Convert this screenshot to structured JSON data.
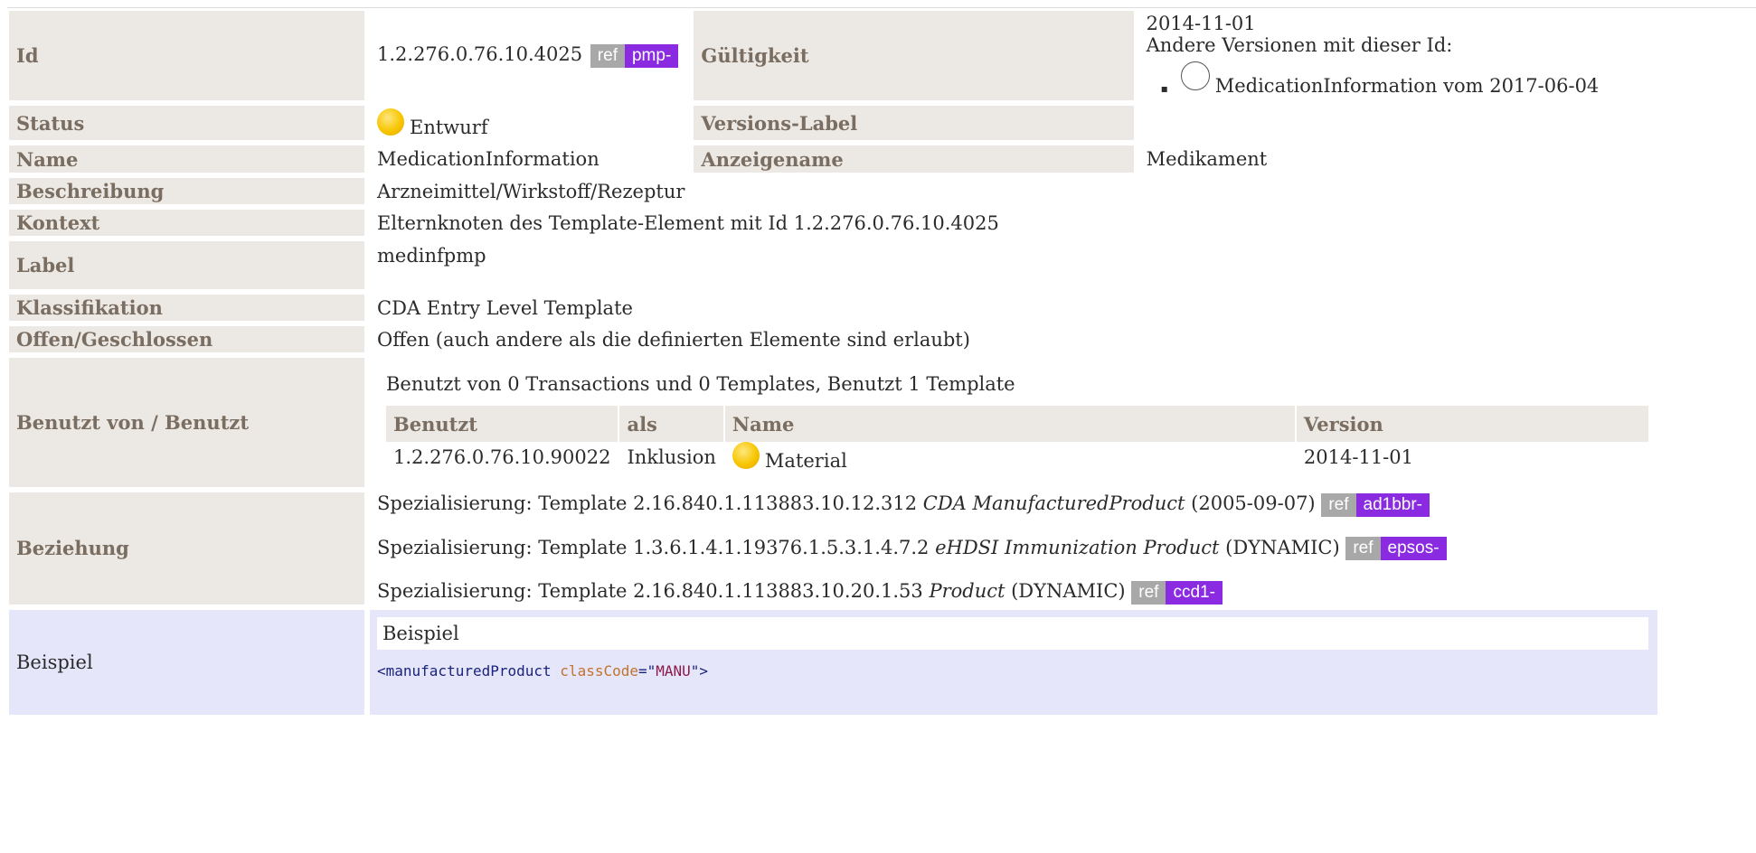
{
  "rows": {
    "id": {
      "label": "Id",
      "value": "1.2.276.0.76.10.4025",
      "ref": "ref",
      "prefix": "pmp-"
    },
    "validity": {
      "label": "Gültigkeit",
      "date": "2014-11-01",
      "other_versions": "Andere Versionen mit dieser Id:",
      "version_item": "MedicationInformation vom 2017-06-04"
    },
    "status": {
      "label": "Status",
      "value": "Entwurf"
    },
    "version_label": {
      "label": "Versions-Label"
    },
    "name": {
      "label": "Name",
      "value": "MedicationInformation"
    },
    "display_name": {
      "label": "Anzeigename",
      "value": "Medikament"
    },
    "description": {
      "label": "Beschreibung",
      "value": "Arzneimittel/Wirkstoff/Rezeptur"
    },
    "context": {
      "label": "Kontext",
      "value": "Elternknoten des Template-Element mit Id 1.2.276.0.76.10.4025"
    },
    "tag": {
      "label": "Label",
      "value": "medinfpmp"
    },
    "classification": {
      "label": "Klassifikation",
      "value": "CDA Entry Level Template"
    },
    "open_closed": {
      "label": "Offen/Geschlossen",
      "value": "Offen (auch andere als die definierten Elemente sind erlaubt)"
    },
    "used_by": {
      "label": "Benutzt von / Benutzt",
      "summary": "Benutzt von 0 Transactions und 0 Templates, Benutzt 1 Template",
      "headers": [
        "Benutzt",
        "als",
        "Name",
        "Version"
      ],
      "row": {
        "id": "1.2.276.0.76.10.90022",
        "as": "Inklusion",
        "name": "Material",
        "version": "2014-11-01"
      }
    },
    "relation": {
      "label": "Beziehung",
      "items": [
        {
          "prefix": "Spezialisierung: Template 2.16.840.1.113883.10.12.312 ",
          "name": "CDA ManufacturedProduct",
          "suffix": " (2005-09-07)",
          "ref": "ref",
          "tag": "ad1bbr-"
        },
        {
          "prefix": "Spezialisierung: Template 1.3.6.1.4.1.19376.1.5.3.1.4.7.2 ",
          "name": "eHDSI Immunization Product",
          "suffix": " (DYNAMIC)",
          "ref": "ref",
          "tag": "epsos-"
        },
        {
          "prefix": "Spezialisierung: Template 2.16.840.1.113883.10.20.1.53 ",
          "name": "Product",
          "suffix": " (DYNAMIC)",
          "ref": "ref",
          "tag": "ccd1-"
        }
      ]
    },
    "example": {
      "label": "Beispiel",
      "box_title": "Beispiel",
      "code_open": "<manufacturedProduct ",
      "code_attr": "classCode",
      "code_eq": "=\"",
      "code_value": "MANU",
      "code_close": "\">"
    }
  }
}
